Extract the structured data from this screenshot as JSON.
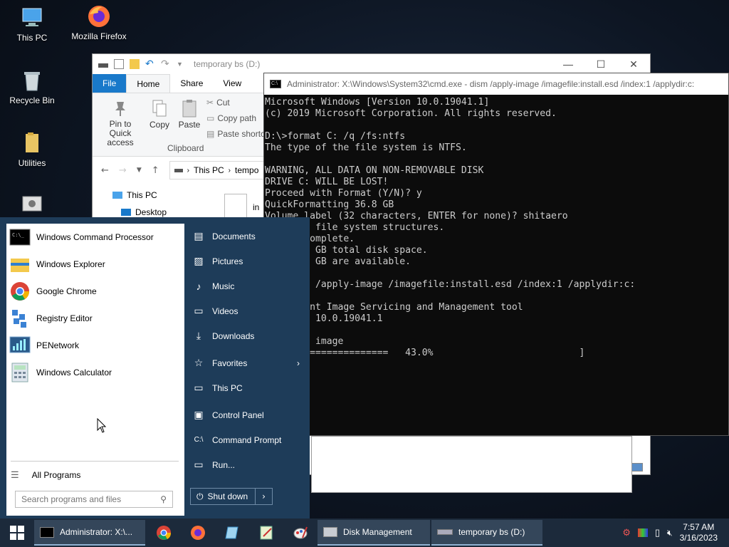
{
  "desktop": {
    "icons": [
      {
        "label": "This PC"
      },
      {
        "label": "Mozilla Firefox"
      },
      {
        "label": "Recycle Bin"
      },
      {
        "label": "Utilities"
      }
    ]
  },
  "explorer": {
    "title": "temporary bs (D:)",
    "tabs": [
      "File",
      "Home",
      "Share",
      "View"
    ],
    "ribbon": {
      "pin_label": "Pin to Quick access",
      "copy_label": "Copy",
      "paste_label": "Paste",
      "cut_label": "Cut",
      "copy_path_label": "Copy path",
      "paste_shortcut_label": "Paste shortcut",
      "group_label": "Clipboard"
    },
    "address": {
      "root": "This PC",
      "current": "tempo"
    },
    "nav": {
      "this_pc": "This PC",
      "desktop": "Desktop"
    },
    "file_partial": "in"
  },
  "cmd": {
    "title": "Administrator: X:\\Windows\\System32\\cmd.exe - dism  /apply-image /imagefile:install.esd /index:1 /applydir:c:",
    "icon_text": "C:\\",
    "lines": [
      "Microsoft Windows [Version 10.0.19041.1]",
      "(c) 2019 Microsoft Corporation. All rights reserved.",
      "",
      "D:\\>format C: /q /fs:ntfs",
      "The type of the file system is NTFS.",
      "",
      "WARNING, ALL DATA ON NON-REMOVABLE DISK",
      "DRIVE C: WILL BE LOST!",
      "Proceed with Format (Y/N)? y",
      "QuickFormatting 36.8 GB",
      "Volume label (32 characters, ENTER for none)? shitaero",
      "Creating file system structures.",
      "Format complete.",
      "    36.8 GB total disk space.",
      "    36.7 GB are available.",
      "",
      "D:\\>dism /apply-image /imagefile:install.esd /index:1 /applydir:c:",
      "",
      "Deployment Image Servicing and Management tool",
      "Version: 10.0.19041.1",
      "",
      "Applying image",
      "[=====================   43.0%                          ]"
    ]
  },
  "start_menu": {
    "programs": [
      {
        "label": "Windows Command Processor"
      },
      {
        "label": "Windows Explorer"
      },
      {
        "label": "Google Chrome"
      },
      {
        "label": "Registry Editor"
      },
      {
        "label": "PENetwork"
      },
      {
        "label": "Windows Calculator"
      }
    ],
    "all_programs": "All Programs",
    "search_placeholder": "Search programs and files",
    "right_items": [
      {
        "label": "Documents"
      },
      {
        "label": "Pictures"
      },
      {
        "label": "Music"
      },
      {
        "label": "Videos"
      },
      {
        "label": "Downloads"
      },
      {
        "label": "Favorites"
      },
      {
        "label": "This PC"
      },
      {
        "label": "Control Panel"
      },
      {
        "label": "Command Prompt"
      },
      {
        "label": "Run..."
      }
    ],
    "shutdown_label": "Shut down"
  },
  "taskbar": {
    "tasks": [
      {
        "label": "Administrator: X:\\..."
      },
      {
        "label": "Disk Management"
      },
      {
        "label": "temporary bs (D:)"
      }
    ],
    "clock": {
      "time": "7:57 AM",
      "date": "3/16/2023"
    }
  },
  "colors": {
    "accent": "#1979ca",
    "start_bg": "#1e3c59",
    "taskbar_bg": "#1c2a3b"
  }
}
